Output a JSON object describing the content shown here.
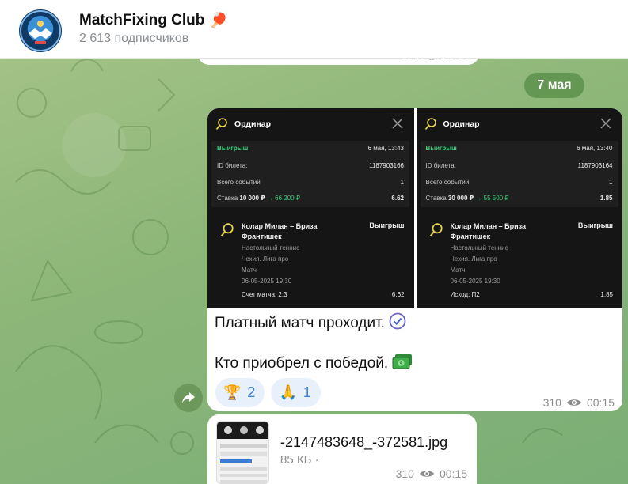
{
  "header": {
    "channel_name": "MatchFixing Club",
    "channel_emoji": "🏓",
    "subscribers": "2 613 подписчиков"
  },
  "prev_message": {
    "meta": "321 👁 23:09"
  },
  "date_chip": "7 мая",
  "tickets": [
    {
      "title": "Ординар",
      "status": "Выигрыш",
      "datetime": "6 мая, 13:43",
      "ticket_label": "ID билета:",
      "ticket_id": "1187903166",
      "events_label": "Всего событий",
      "events_count": "1",
      "stake_label": "Ставка",
      "stake": "10 000 ₽",
      "payout": "66 200 ₽",
      "odds": "6.62",
      "match": "Колар Милан – Бриза Франтишек",
      "match_status": "Выигрыш",
      "sport": "Настольный теннис",
      "league": "Чехия. Лига про",
      "market": "Матч",
      "date": "06-05-2025 19:30",
      "outcome": "Счет матча: 2:3",
      "outcome_odds": "6.62"
    },
    {
      "title": "Ординар",
      "status": "Выигрыш",
      "datetime": "6 мая, 13:40",
      "ticket_label": "ID билета:",
      "ticket_id": "1187903164",
      "events_label": "Всего событий",
      "events_count": "1",
      "stake_label": "Ставка",
      "stake": "30 000 ₽",
      "payout": "55 500 ₽",
      "odds": "1.85",
      "match": "Колар Милан – Бриза Франтишек",
      "match_status": "Выигрыш",
      "sport": "Настольный теннис",
      "league": "Чехия. Лига про",
      "market": "Матч",
      "date": "06-05-2025 19:30",
      "outcome": "Исход: П2",
      "outcome_odds": "1.85"
    }
  ],
  "post": {
    "line1": "Платный матч проходит.",
    "line2": "Кто приобрел с победой.",
    "views": "310",
    "time": "00:15"
  },
  "reactions": [
    {
      "emoji": "🏆",
      "count": "2"
    },
    {
      "emoji": "🙏",
      "count": "1"
    }
  ],
  "file": {
    "name": "-2147483648_-372581.jpg",
    "size": "85 КБ ·",
    "views": "310",
    "time": "00:15"
  }
}
